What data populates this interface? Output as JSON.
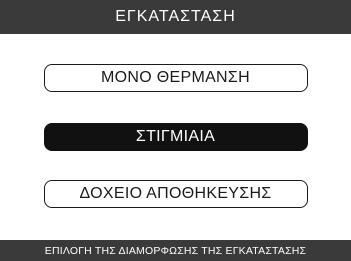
{
  "header": {
    "title": "ΕΓΚΑΤΑΣΤΑΣΗ"
  },
  "menu": {
    "options": [
      {
        "label": "ΜΟΝΟ ΘΕΡΜΑΝΣΗ",
        "selected": false
      },
      {
        "label": "ΣΤΙΓΜΙΑΙΑ",
        "selected": true
      },
      {
        "label": "ΔΟΧΕΙΟ ΑΠΟΘΗΚΕΥΣΗΣ",
        "selected": false
      }
    ]
  },
  "footer": {
    "hint": "ΕΠΙΛΟΓΗ ΤΗΣ ΔΙΑΜΟΡΦΩΣΗΣ ΤΗΣ ΕΓΚΑΤΑΣΤΑΣΗΣ"
  },
  "colors": {
    "bar_background": "#3a3a3a",
    "selected_background": "#111111",
    "text_dark": "#1a1a1a",
    "text_light": "#ffffff"
  }
}
